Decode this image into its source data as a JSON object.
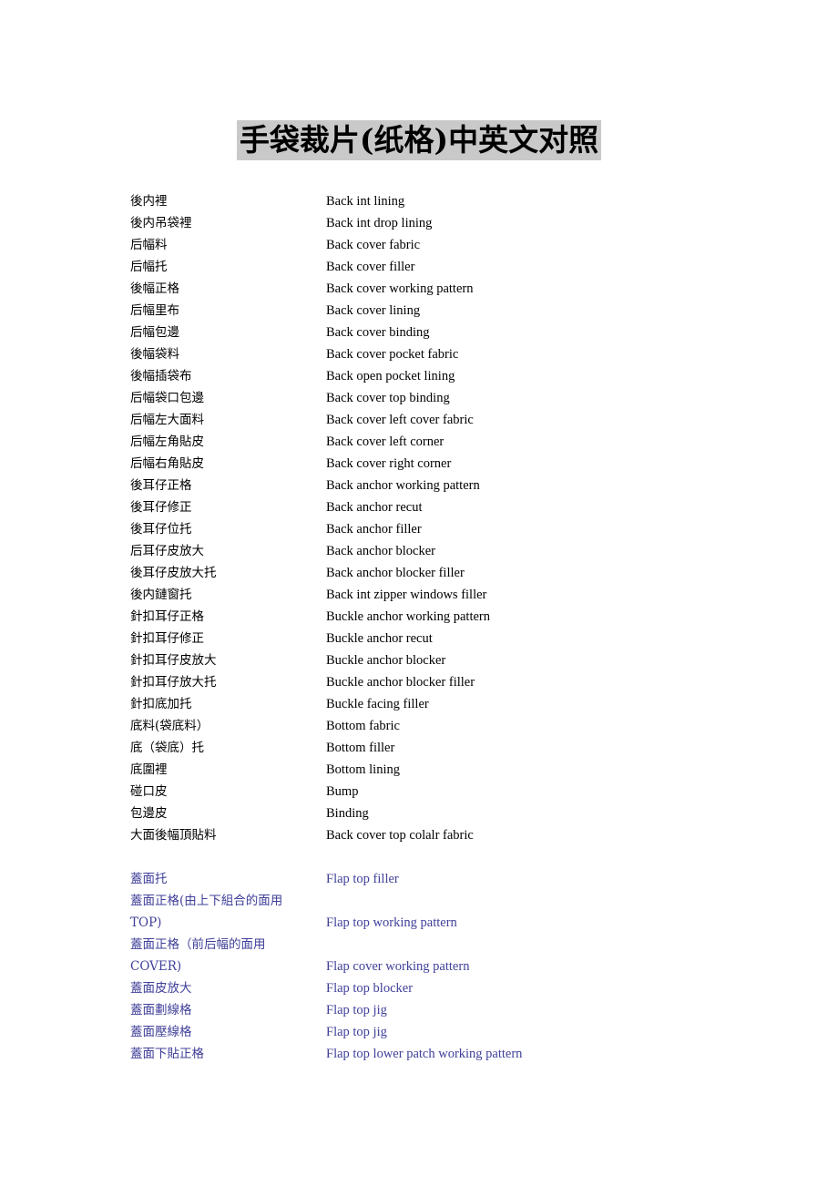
{
  "document": {
    "title": "手袋裁片(纸格)中英文对照",
    "title_highlight_color": "#c9c9c9",
    "text_color": "#000000",
    "accent_color": "#40409a"
  },
  "sections": [
    {
      "name": "black-section",
      "color": "#000000",
      "rows": [
        {
          "cn": "後内裡",
          "en": "Back int lining"
        },
        {
          "cn": "後内吊袋裡",
          "en": "Back int drop lining"
        },
        {
          "cn": "后幅料",
          "en": "Back cover fabric"
        },
        {
          "cn": "后幅托",
          "en": "Back cover filler"
        },
        {
          "cn": "後幅正格",
          "en": "Back cover working pattern"
        },
        {
          "cn": "后幅里布",
          "en": "Back cover lining"
        },
        {
          "cn": "后幅包邊",
          "en": "Back cover binding"
        },
        {
          "cn": "後幅袋料",
          "en": "Back cover pocket fabric"
        },
        {
          "cn": "後幅插袋布",
          "en": "Back open pocket lining"
        },
        {
          "cn": "后幅袋口包邊",
          "en": "Back cover top binding"
        },
        {
          "cn": "后幅左大面料",
          "en": "Back cover left cover fabric"
        },
        {
          "cn": "后幅左角貼皮",
          "en": "Back cover left corner"
        },
        {
          "cn": "后幅右角貼皮",
          "en": "Back cover right corner"
        },
        {
          "cn": "後耳仔正格",
          "en": "Back anchor working pattern"
        },
        {
          "cn": "後耳仔修正",
          "en": "Back anchor recut"
        },
        {
          "cn": "後耳仔位托",
          "en": "Back anchor filler"
        },
        {
          "cn": "后耳仔皮放大",
          "en": "Back anchor blocker"
        },
        {
          "cn": "後耳仔皮放大托",
          "en": "Back anchor blocker filler"
        },
        {
          "cn": "後内鏈窗托",
          "en": "Back int zipper windows filler"
        },
        {
          "cn": "針扣耳仔正格",
          "en": "Buckle anchor working pattern"
        },
        {
          "cn": "針扣耳仔修正",
          "en": "Buckle anchor recut"
        },
        {
          "cn": "針扣耳仔皮放大",
          "en": "Buckle anchor blocker"
        },
        {
          "cn": "針扣耳仔放大托",
          "en": "Buckle anchor blocker filler"
        },
        {
          "cn": "針扣底加托",
          "en": "Buckle facing filler"
        },
        {
          "cn": "底料(袋底料）",
          "en": "Bottom fabric"
        },
        {
          "cn": "底（袋底）托",
          "en": "Bottom filler"
        },
        {
          "cn": "底圍裡",
          "en": "Bottom lining"
        },
        {
          "cn": "碰口皮",
          "en": "Bump"
        },
        {
          "cn": "包邊皮",
          "en": "Binding"
        },
        {
          "cn": "大面後幅頂貼料",
          "en": "Back cover top colalr fabric"
        }
      ]
    },
    {
      "name": "blue-section",
      "color": "#40409a",
      "rows": [
        {
          "cn": "蓋面托",
          "en": "Flap top filler"
        },
        {
          "cn": "蓋面正格(由上下組合的面用",
          "en": ""
        },
        {
          "cn": "TOP)",
          "en": "Flap top working pattern"
        },
        {
          "cn": "蓋面正格（前后幅的面用",
          "en": ""
        },
        {
          "cn": "COVER)",
          "en": "Flap cover working pattern"
        },
        {
          "cn": "蓋面皮放大",
          "en": "Flap top blocker"
        },
        {
          "cn": "蓋面劃線格",
          "en": "Flap top jig"
        },
        {
          "cn": "蓋面壓線格",
          "en": "Flap top jig"
        },
        {
          "cn": "蓋面下貼正格",
          "en": "Flap top lower patch working pattern"
        }
      ]
    }
  ]
}
